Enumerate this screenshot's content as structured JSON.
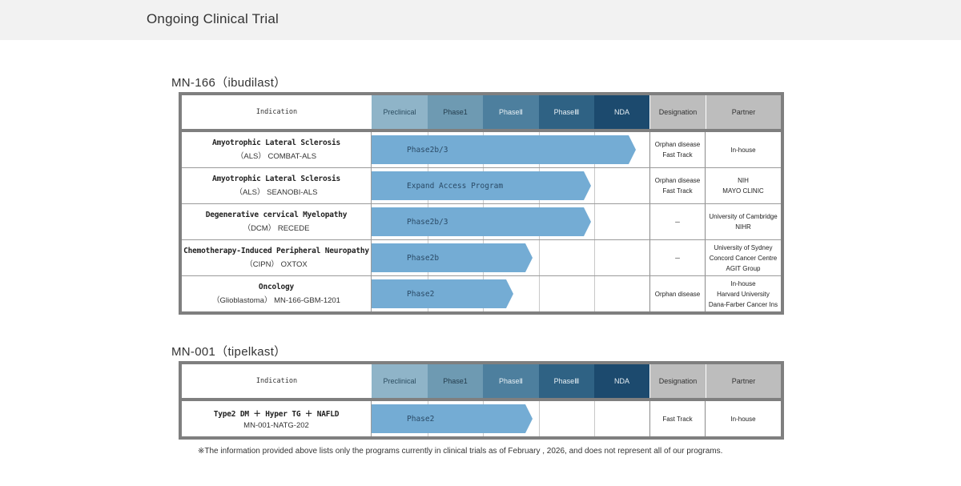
{
  "header": {
    "title": "Ongoing Clinical Trial"
  },
  "columns": {
    "indication": "Indication",
    "preclinical": "Preclinical",
    "phase1": "Phase1",
    "phase2": "PhaseⅡ",
    "phase3": "PhaseⅢ",
    "nda": "NDA",
    "designation": "Designation",
    "partner": "Partner"
  },
  "pipelines": [
    {
      "title": "MN-166（ibudilast）",
      "rows": [
        {
          "indication": "Amyotrophic Lateral Sclerosis",
          "sub": "（ALS） COMBAT-ALS",
          "program": "Phase2b/3",
          "progress_pct": 95,
          "designation": [
            "Orphan disease",
            "Fast Track"
          ],
          "partner": [
            "In-house"
          ]
        },
        {
          "indication": "Amyotrophic Lateral Sclerosis",
          "sub": "（ALS） SEANOBI-ALS",
          "program": "Expand Access Program",
          "progress_pct": 79,
          "designation": [
            "Orphan disease",
            "Fast Track"
          ],
          "partner": [
            "NIH",
            "MAYO CLINIC"
          ]
        },
        {
          "indication": "Degenerative cervical Myelopathy",
          "sub": "（DCM） RECEDE",
          "program": "Phase2b/3",
          "progress_pct": 79,
          "designation": [
            "－"
          ],
          "partner": [
            "University of Cambridge",
            "NIHR"
          ]
        },
        {
          "indication": "Chemotherapy-Induced Peripheral Neuropathy",
          "sub": "（CIPN） OXTOX",
          "program": "Phase2b",
          "progress_pct": 58,
          "designation": [
            "－"
          ],
          "partner": [
            "University of Sydney",
            "Concord Cancer Centre",
            "AGIT Group"
          ]
        },
        {
          "indication": "Oncology",
          "sub": "（Glioblastoma） MN-166-GBM-1201",
          "program": "Phase2",
          "progress_pct": 51,
          "designation": [
            "Orphan disease"
          ],
          "partner": [
            "In-house",
            "Harvard University",
            "Dana-Farber Cancer Ins"
          ]
        }
      ]
    },
    {
      "title": "MN-001（tipelkast）",
      "rows": [
        {
          "indication": "Type2 DM ＋ Hyper TG ＋ NAFLD",
          "sub": "MN-001-NATG-202",
          "program": "Phase2",
          "progress_pct": 58,
          "designation": [
            "Fast Track"
          ],
          "partner": [
            "In-house"
          ]
        }
      ]
    }
  ],
  "footnote": "※The information provided above lists only the programs currently in clinical trials as of February , 2026, and does not represent all of our programs.",
  "colors": {
    "bar": "#74acd4",
    "preclinical": "#8fb4c8",
    "phase1": "#6e9ab2",
    "phase2": "#4d7f9e",
    "phase3": "#2f6284",
    "nda": "#1c4a6e",
    "meta_header": "#bdbdbd"
  }
}
